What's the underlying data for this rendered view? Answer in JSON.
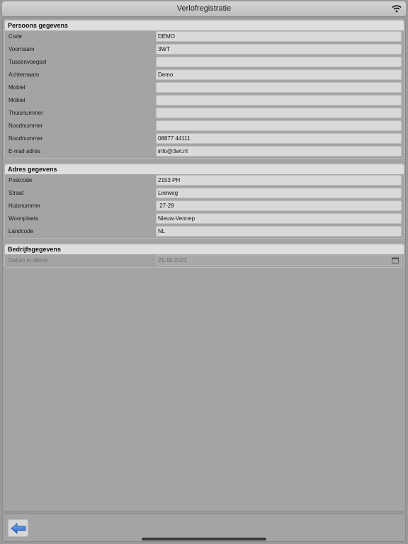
{
  "app": {
    "title": "Verlofregistratie"
  },
  "sections": {
    "persoons": {
      "header": "Persoons gegevens",
      "rows": [
        {
          "label": "Code",
          "value": "DEMO"
        },
        {
          "label": "Voornaam",
          "value": "3WT"
        },
        {
          "label": "Tussenvoegsel",
          "value": ""
        },
        {
          "label": "Achternaam",
          "value": "Demo"
        },
        {
          "label": "Mobiel",
          "value": ""
        },
        {
          "label": "Mobiel",
          "value": ""
        },
        {
          "label": "Thuisnummer",
          "value": ""
        },
        {
          "label": "Noodnummer",
          "value": ""
        },
        {
          "label": "Noodnummer",
          "value": "08877 44111"
        },
        {
          "label": "E-mail adres",
          "value": "info@3wt.nl"
        }
      ]
    },
    "adres": {
      "header": "Adres gegevens",
      "rows": [
        {
          "label": "Postcode",
          "value": "2153 PH"
        },
        {
          "label": "Straat",
          "value": "Lireweg"
        },
        {
          "label": "Huisnummer",
          "value": " 27-29"
        },
        {
          "label": "Woonplaats",
          "value": "Nieuw-Vennep"
        },
        {
          "label": "Landcode",
          "value": "NL"
        }
      ]
    },
    "bedrijf": {
      "header": "Bedrijfsgegevens",
      "rows": [
        {
          "label": "Datum in dienst",
          "value": "21-10-2021"
        }
      ]
    }
  },
  "icons": {
    "status": "wifi-icon",
    "date": "calendar-icon",
    "back": "back-arrow-icon"
  },
  "colors": {
    "accent": "#2f7de1"
  }
}
